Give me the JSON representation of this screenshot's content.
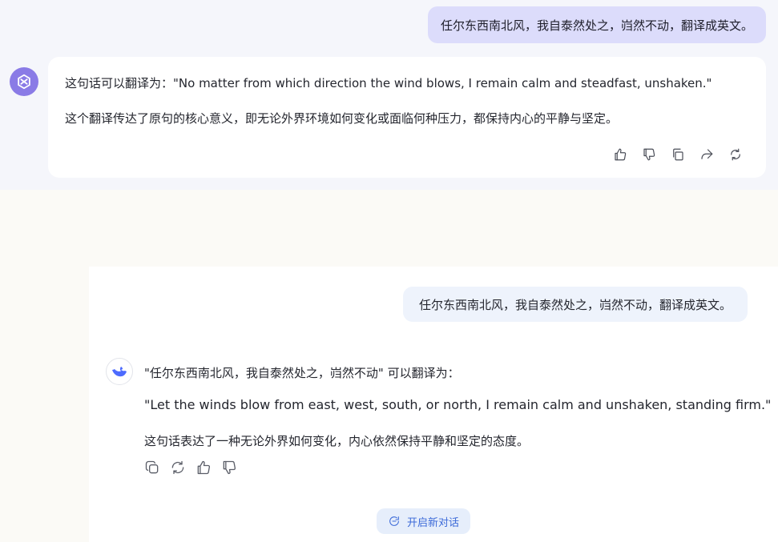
{
  "top": {
    "user_message": "任尔东西南北风，我自泰然处之，岿然不动，翻译成英文。",
    "answer": {
      "line1": "这句话可以翻译为：\"No matter from which direction the wind blows, I remain calm and steadfast, unshaken.\"",
      "line2": "这个翻译传达了原句的核心意义，即无论外界环境如何变化或面临何种压力，都保持内心的平静与坚定。"
    },
    "actions": [
      "thumbs-up-icon",
      "thumbs-down-icon",
      "copy-icon",
      "share-icon",
      "regenerate-icon"
    ],
    "avatar_color": "#8a7be6"
  },
  "bottom": {
    "user_message": "任尔东西南北风，我自泰然处之，岿然不动，翻译成英文。",
    "answer": {
      "line1": "\"任尔东西南北风，我自泰然处之，岿然不动\" 可以翻译为：",
      "line2": "\"Let the winds blow from east, west, south, or north, I remain calm and unshaken, standing firm.\"",
      "line3": "这句话表达了一种无论外界如何变化，内心依然保持平静和坚定的态度。"
    },
    "actions": [
      "copy-icon",
      "regenerate-icon",
      "thumbs-up-icon",
      "thumbs-down-icon"
    ],
    "new_chat_label": "开启新对话",
    "accent_color": "#3c6ad8"
  }
}
